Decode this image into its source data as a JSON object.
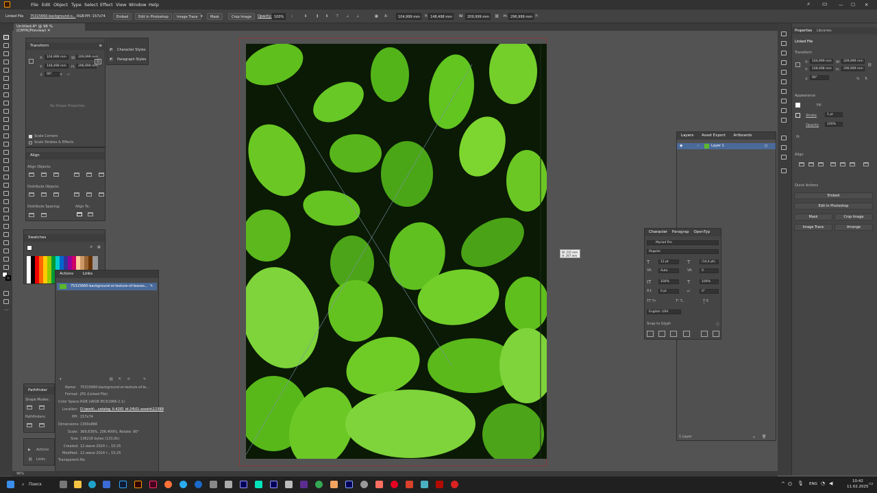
{
  "menubar": {
    "items": [
      "File",
      "Edit",
      "Object",
      "Type",
      "Select",
      "Effect",
      "View",
      "Window",
      "Help"
    ]
  },
  "control_bar": {
    "linked_file": "Linked File",
    "file_name": "75315660-background-o...",
    "color_mode": "RGB",
    "ppi": "PPI: 157x74",
    "embed": "Embed",
    "edit_photoshop": "Edit In Photoshop",
    "image_trace": "Image Trace",
    "mask": "Mask",
    "crop_image": "Crop Image",
    "opacity_label": "Opacity:",
    "opacity": "100%",
    "x": "104,999 mm",
    "y": "148,498 mm",
    "w": "209,999 mm",
    "h": "296,999 mm"
  },
  "document_tab": {
    "title": "Untitled-6* @ 96 % (CMYK/Preview)"
  },
  "transform_panel": {
    "title": "Transform",
    "x": "104,999 mm",
    "y": "148,498 mm",
    "w": "209,999 mm",
    "h": "296,999 mm",
    "angle": "90°",
    "no_shape": "No Shape Properties",
    "scale_corners": "Scale Corners",
    "scale_strokes": "Scale Strokes & Effects"
  },
  "styles_panel": {
    "character_styles": "Character Styles",
    "paragraph_styles": "Paragraph Styles"
  },
  "align_panel": {
    "title": "Align",
    "align_objects": "Align Objects:",
    "distribute_objects": "Distribute Objects:",
    "distribute_spacing": "Distribute Spacing:",
    "align_to": "Align To:"
  },
  "swatches_panel": {
    "title": "Swatches"
  },
  "links_panel": {
    "tabs": [
      "Actions",
      "Links"
    ],
    "item": "75315660-background-or-texture-of-leaves...",
    "name_label": "Name:",
    "name": "75315660-background-or-texture-of-le...",
    "format_label": "Format:",
    "format": "JPG (Linked File)",
    "color_space_label": "Color Space:",
    "color_space": "RGB (sRGB IEC61966-2.1)",
    "location_label": "Location:",
    "location": "D:\\work\\...catalog_II-42ID_id-24\\01-assets\\12399",
    "ppi_label": "PPI:",
    "ppi": "157x74",
    "dimensions_label": "Dimensions:",
    "dimensions": "1300x866",
    "scale_label": "Scale:",
    "scale": "369,836%, 206,409%; Rotate: 90°",
    "size_label": "Size:",
    "size": "136216 bytes (133,0k)",
    "created_label": "Created:",
    "created": "12 июня 2024 г., 15:25",
    "modified_label": "Modified:",
    "modified": "12 июня 2024 г., 15:25",
    "transparent_label": "Transparent:",
    "transparent": "No"
  },
  "pathfinder_panel": {
    "title": "Pathfinder",
    "shape_modes": "Shape Modes:",
    "pathfinders": "Pathfinders:"
  },
  "actions_panel": {
    "actions": "Actions",
    "links": "Links"
  },
  "layers_panel": {
    "tabs": [
      "Layers",
      "Asset Export",
      "Artboards"
    ],
    "layer_name": "Layer 1",
    "footer": "1 Layer"
  },
  "character_panel": {
    "tabs": [
      "Character",
      "Paragrap",
      "OpenTyp"
    ],
    "font": "Myriad Pro",
    "style": "Regular",
    "size": "12 pt",
    "leading": "(14,4 pt)",
    "kerning": "Auto",
    "tracking": "0",
    "vscale": "100%",
    "hscale": "100%",
    "baseline": "0 pt",
    "rotation": "0°",
    "language": "English: USA",
    "snap": "Snap to Glyph"
  },
  "tooltip": {
    "w": "W: 215 mm",
    "h": "H: 297 mm"
  },
  "properties_panel": {
    "tabs": [
      "Properties",
      "Libraries"
    ],
    "linked_file": "Linked File",
    "transform": "Transform",
    "x": "104,999 mm",
    "y": "148,498 mm",
    "w": "209,999 mm",
    "h": "296,999 mm",
    "angle": "90°",
    "appearance": "Appearance",
    "fill": "Fill",
    "stroke": "Stroke",
    "stroke_value": "1 pt",
    "opacity": "Opacity",
    "opacity_value": "100%",
    "fx": "fx.",
    "align": "Align",
    "quick_actions": "Quick Actions",
    "embed": "Embed",
    "edit_photoshop": "Edit In Photoshop",
    "mask": "Mask",
    "crop_image": "Crop Image",
    "image_trace": "Image Trace",
    "arrange": "Arrange"
  },
  "status": {
    "zoom": "96%"
  },
  "taskbar": {
    "search": "Поиск",
    "lang": "ENG",
    "time": "10:42",
    "date": "11.02.2025"
  }
}
